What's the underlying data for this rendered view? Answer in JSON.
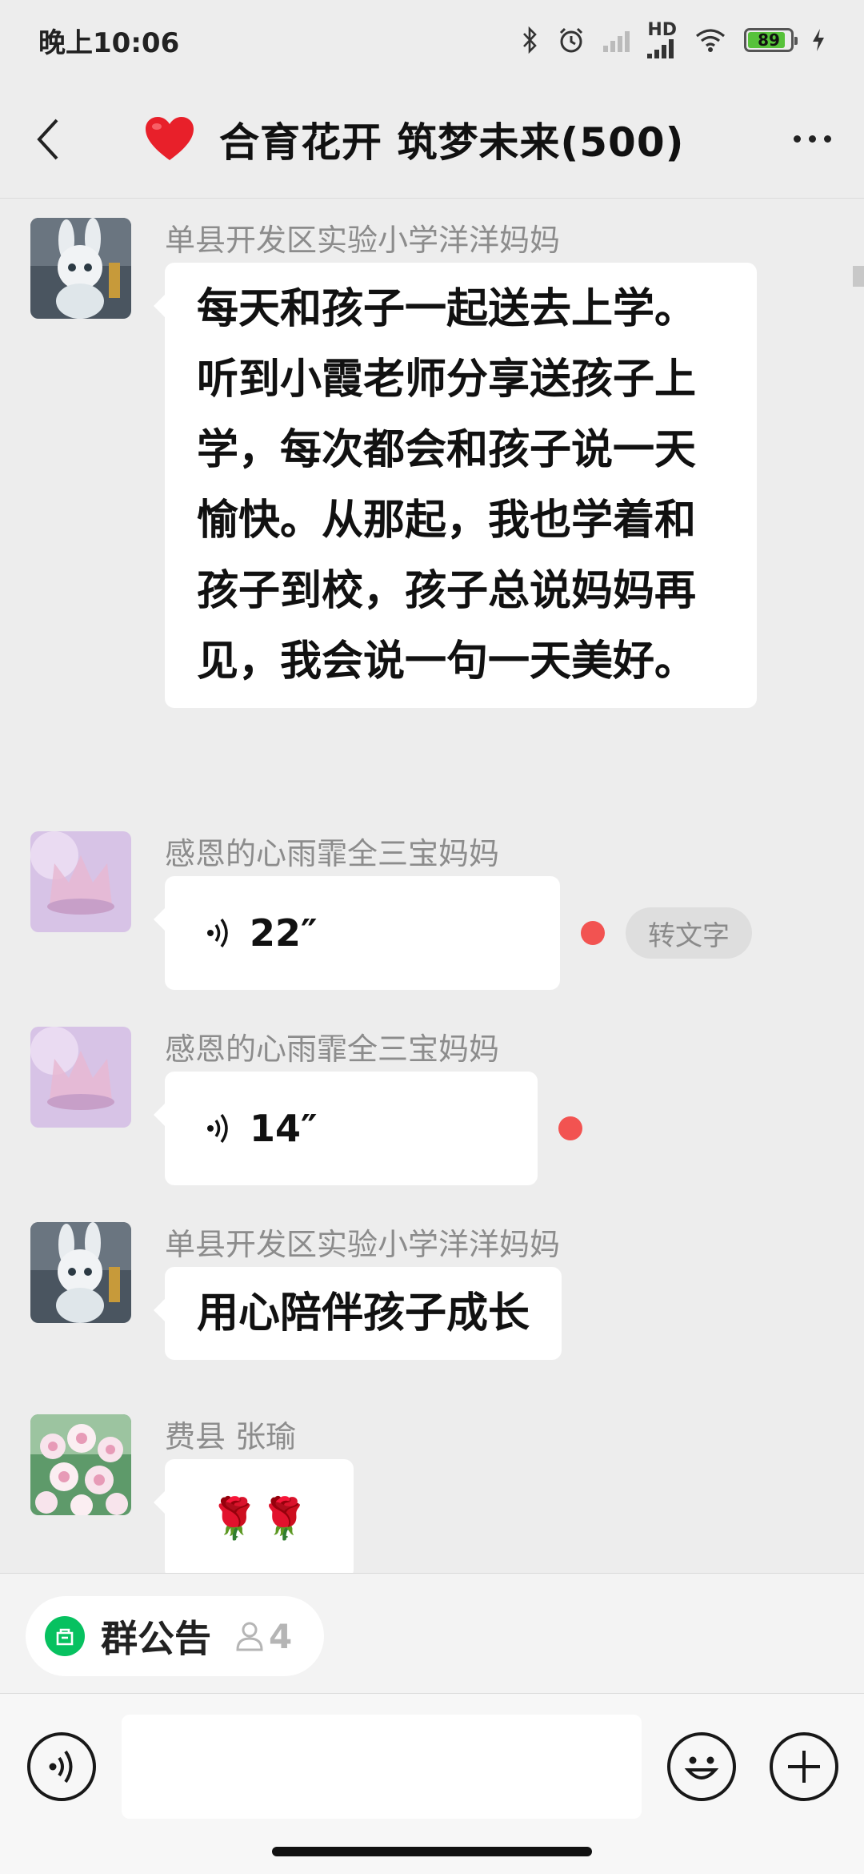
{
  "status_bar": {
    "time": "晚上10:06",
    "network_label": "HD",
    "battery": "89",
    "battery_level_percent": 89
  },
  "header": {
    "emoji": "❤️",
    "title": "合育花开 筑梦未来(500)",
    "back_icon": "chevron-left-icon",
    "more_icon": "more-dots-icon"
  },
  "messages": [
    {
      "sender": "单县开发区实验小学洋洋妈妈",
      "type": "text",
      "text": "每天和孩子一起送去上学。听到小霞老师分享送孩子上学，每次都会和孩子说一天愉快。从那起，我也学着和孩子到校，孩子总说妈妈再见，我会说一句一天美好。"
    },
    {
      "sender": "感恩的心雨霏全三宝妈妈",
      "type": "voice",
      "duration": "22″",
      "convert_label": "转文字"
    },
    {
      "sender": "感恩的心雨霏全三宝妈妈",
      "type": "voice",
      "duration": "14″"
    },
    {
      "sender": "单县开发区实验小学洋洋妈妈",
      "type": "text",
      "text": "用心陪伴孩子成长"
    },
    {
      "sender": "费县 张瑜",
      "type": "text",
      "text": "🌹🌹"
    }
  ],
  "notice": {
    "label": "群公告",
    "count": "4"
  },
  "colors": {
    "background": "#ededed",
    "bubble": "#ffffff",
    "unread": "#f25351",
    "notice_icon": "#07c160",
    "battery": "#57c23a"
  }
}
